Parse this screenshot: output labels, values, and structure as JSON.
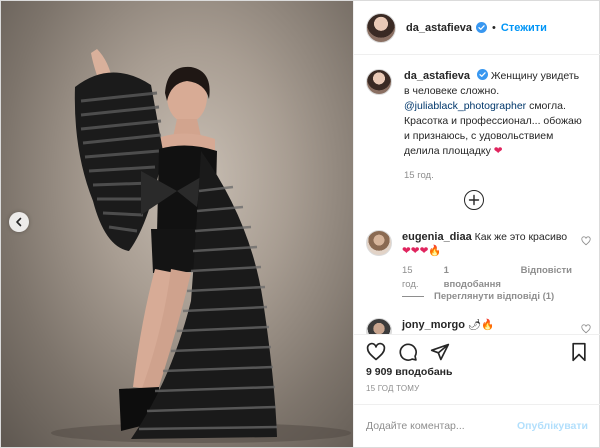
{
  "post": {
    "author": "da_astafieva",
    "follow_label": "Стежити",
    "dot": "•"
  },
  "caption": {
    "author": "da_astafieva",
    "text1": "Женщину увидеть в человеке сложно.",
    "mention": "@juliablack_photographer",
    "text2": "смогла. Красотка и профессионал... обожаю и признаюсь, с удовольствием делила площадку",
    "emoji": "❤",
    "time": "15 год."
  },
  "comments": [
    {
      "author": "eugenia_diaa",
      "text": "Как же это красиво",
      "emoji": "❤❤❤🔥",
      "time": "15 год.",
      "likes": "1 вподобання",
      "reply": "Відповісти"
    },
    {
      "author": "jony_morgo",
      "emoji": "🌶🔥"
    }
  ],
  "replies_label": "Переглянути відповіді (1)",
  "likes_count": "9 909 вподобань",
  "time_ago": "15 ГОД ТОМУ",
  "add_comment": {
    "placeholder": "Додайте коментар...",
    "publish": "Опублікувати"
  },
  "icons": {
    "like": "heart-outline-icon",
    "comment": "comment-icon",
    "share": "share-icon",
    "save": "bookmark-icon",
    "more": "plus-circle-icon",
    "prev": "chevron-left-icon"
  },
  "colors": {
    "accent": "#0095f6",
    "link": "#00376b",
    "muted": "#8e8e8e",
    "publish_disabled": "#b2dffc"
  }
}
